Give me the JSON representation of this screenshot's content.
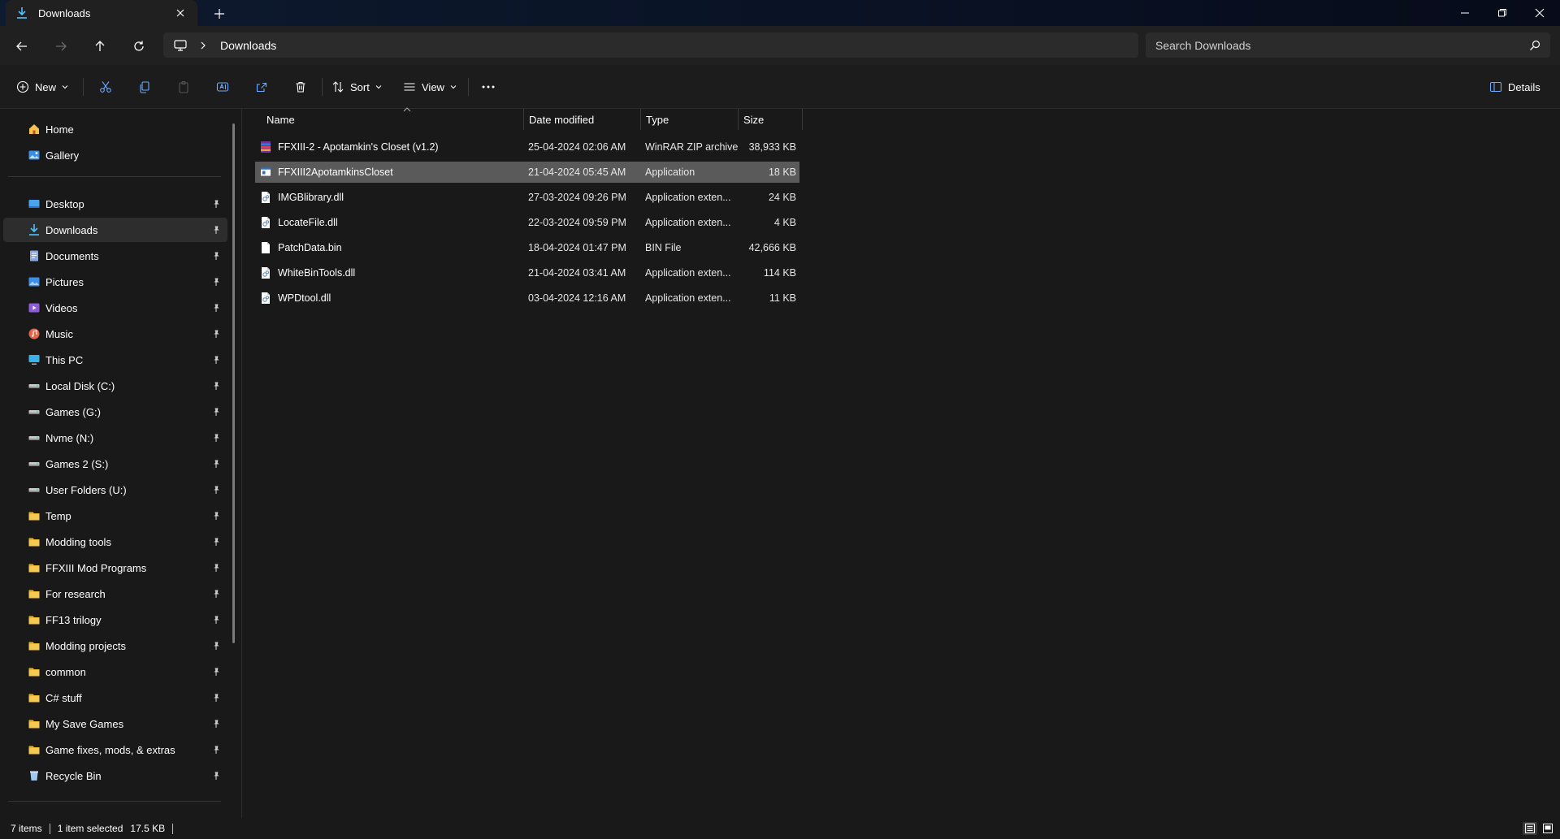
{
  "window": {
    "tab_title": "Downloads",
    "colors": {
      "titlebar": "#0a1326",
      "accent": "#4cc2ff",
      "folder": "#f2c34f"
    }
  },
  "nav": {
    "breadcrumb": "Downloads",
    "search_placeholder": "Search Downloads"
  },
  "toolbar": {
    "new_label": "New",
    "sort_label": "Sort",
    "view_label": "View",
    "details_label": "Details"
  },
  "sidebar": {
    "top": [
      {
        "label": "Home",
        "icon": "home-icon"
      },
      {
        "label": "Gallery",
        "icon": "gallery-icon"
      }
    ],
    "pinned": [
      {
        "label": "Desktop",
        "icon": "desktop-icon"
      },
      {
        "label": "Downloads",
        "icon": "download-icon",
        "selected": true
      },
      {
        "label": "Documents",
        "icon": "documents-icon"
      },
      {
        "label": "Pictures",
        "icon": "pictures-icon"
      },
      {
        "label": "Videos",
        "icon": "videos-icon"
      },
      {
        "label": "Music",
        "icon": "music-icon"
      },
      {
        "label": "This PC",
        "icon": "pc-icon"
      },
      {
        "label": "Local Disk (C:)",
        "icon": "drive-icon"
      },
      {
        "label": "Games (G:)",
        "icon": "drive-icon"
      },
      {
        "label": "Nvme (N:)",
        "icon": "drive-icon"
      },
      {
        "label": "Games 2 (S:)",
        "icon": "drive-icon"
      },
      {
        "label": "User Folders (U:)",
        "icon": "drive-icon"
      },
      {
        "label": "Temp",
        "icon": "folder-icon"
      },
      {
        "label": "Modding tools",
        "icon": "folder-icon"
      },
      {
        "label": "FFXIII Mod Programs",
        "icon": "folder-icon"
      },
      {
        "label": "For research",
        "icon": "folder-icon"
      },
      {
        "label": "FF13 trilogy",
        "icon": "folder-icon"
      },
      {
        "label": "Modding projects",
        "icon": "folder-icon"
      },
      {
        "label": "common",
        "icon": "folder-icon"
      },
      {
        "label": "C# stuff",
        "icon": "folder-icon"
      },
      {
        "label": "My Save Games",
        "icon": "folder-icon"
      },
      {
        "label": "Game fixes, mods, & extras",
        "icon": "folder-icon"
      },
      {
        "label": "Recycle Bin",
        "icon": "recycle-bin-icon"
      }
    ]
  },
  "list": {
    "columns": {
      "name": "Name",
      "date": "Date modified",
      "type": "Type",
      "size": "Size"
    },
    "files": [
      {
        "name": "FFXIII-2 - Apotamkin's Closet (v1.2)",
        "date": "25-04-2024 02:06 AM",
        "type": "WinRAR ZIP archive",
        "size": "38,933 KB",
        "icon": "zip-archive-icon"
      },
      {
        "name": "FFXIII2ApotamkinsCloset",
        "date": "21-04-2024 05:45 AM",
        "type": "Application",
        "size": "18 KB",
        "icon": "application-icon",
        "selected": true
      },
      {
        "name": "IMGBlibrary.dll",
        "date": "27-03-2024 09:26 PM",
        "type": "Application exten...",
        "size": "24 KB",
        "icon": "dll-file-icon"
      },
      {
        "name": "LocateFile.dll",
        "date": "22-03-2024 09:59 PM",
        "type": "Application exten...",
        "size": "4 KB",
        "icon": "dll-file-icon"
      },
      {
        "name": "PatchData.bin",
        "date": "18-04-2024 01:47 PM",
        "type": "BIN File",
        "size": "42,666 KB",
        "icon": "file-icon"
      },
      {
        "name": "WhiteBinTools.dll",
        "date": "21-04-2024 03:41 AM",
        "type": "Application exten...",
        "size": "114 KB",
        "icon": "dll-file-icon"
      },
      {
        "name": "WPDtool.dll",
        "date": "03-04-2024 12:16 AM",
        "type": "Application exten...",
        "size": "11 KB",
        "icon": "dll-file-icon"
      }
    ]
  },
  "status": {
    "item_count": "7 items",
    "selection": "1 item selected",
    "selection_size": "17.5 KB"
  }
}
